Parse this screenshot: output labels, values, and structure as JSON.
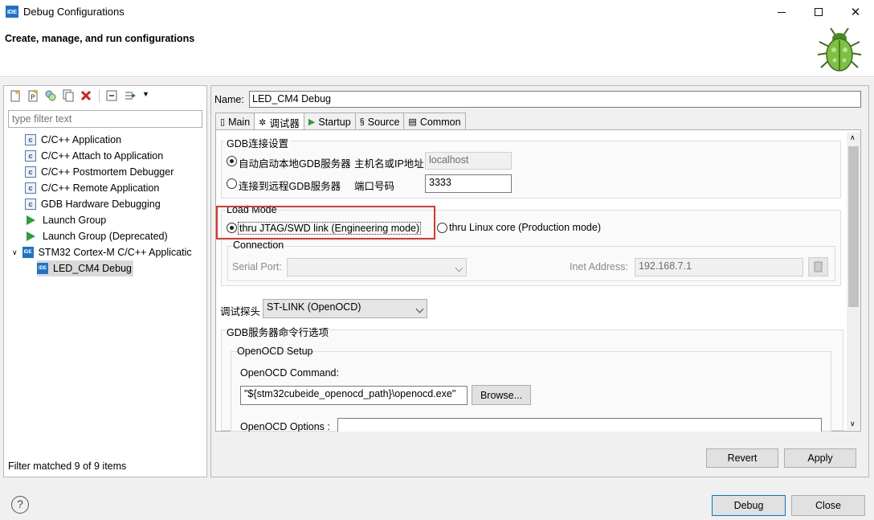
{
  "window": {
    "logo_text": "IDE",
    "title": "Debug Configurations",
    "header_title": "Create, manage, and run configurations"
  },
  "filter": {
    "placeholder": "type filter text"
  },
  "tree": {
    "items": [
      {
        "label": "C/C++ Application"
      },
      {
        "label": "C/C++ Attach to Application"
      },
      {
        "label": "C/C++ Postmortem Debugger"
      },
      {
        "label": "C/C++ Remote Application"
      },
      {
        "label": "GDB Hardware Debugging"
      },
      {
        "label": "Launch Group"
      },
      {
        "label": "Launch Group (Deprecated)"
      },
      {
        "label": "STM32 Cortex-M C/C++ Applicatic"
      },
      {
        "label": "LED_CM4 Debug"
      }
    ],
    "status": "Filter matched 9 of 9 items"
  },
  "config": {
    "name_label": "Name:",
    "name_value": "LED_CM4 Debug",
    "tabs": [
      {
        "label": "Main"
      },
      {
        "label": "调试器"
      },
      {
        "label": "Startup"
      },
      {
        "label": "Source"
      },
      {
        "label": "Common"
      }
    ]
  },
  "debugger": {
    "gdb_group_title": "GDB连接设置",
    "auto_start_label": "自动启动本地GDB服务器",
    "host_label": "主机名或IP地址",
    "host_value": "localhost",
    "remote_label": "连接到远程GDB服务器",
    "port_label": "端口号码",
    "port_value": "3333",
    "load_mode_title": "Load Mode",
    "jtag_label": "thru JTAG/SWD link (Engineering mode)",
    "linux_label": "thru Linux core (Production mode)",
    "connection_title": "Connection",
    "serial_port_label": "Serial Port:",
    "inet_label": "Inet Address:",
    "inet_value": "192.168.7.1",
    "probe_label": "调试探头",
    "probe_value": "ST-LINK (OpenOCD)",
    "server_options_title": "GDB服务器命令行选项",
    "openocd_setup_title": "OpenOCD Setup",
    "openocd_command_label": "OpenOCD Command:",
    "openocd_command_value": "\"${stm32cubeide_openocd_path}\\openocd.exe\"",
    "browse_label": "Browse...",
    "openocd_options_label": "OpenOCD Options :"
  },
  "buttons": {
    "revert": "Revert",
    "apply": "Apply",
    "debug": "Debug",
    "close": "Close"
  },
  "help_icon": "question-mark-icon",
  "colors": {
    "highlight": "#e0342b",
    "accent": "#1e73c8"
  }
}
